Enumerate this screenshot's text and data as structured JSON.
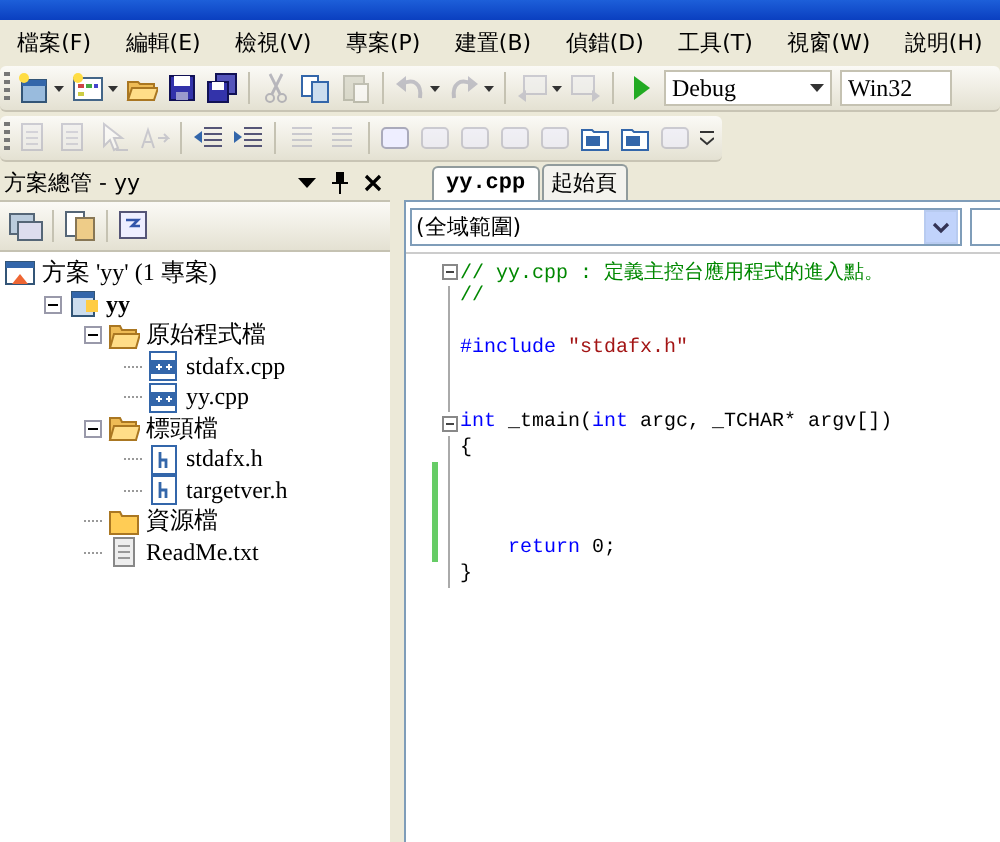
{
  "menu": [
    "檔案(F)",
    "編輯(E)",
    "檢視(V)",
    "專案(P)",
    "建置(B)",
    "偵錯(D)",
    "工具(T)",
    "視窗(W)",
    "說明(H)"
  ],
  "toolbar": [
    {
      "kind": "new-project",
      "disabled": false,
      "dropdown": true
    },
    {
      "kind": "add-item",
      "disabled": false,
      "dropdown": true
    },
    {
      "kind": "open",
      "disabled": false,
      "dropdown": false
    },
    {
      "kind": "save",
      "disabled": false,
      "dropdown": false
    },
    {
      "kind": "save-all",
      "disabled": false,
      "dropdown": false
    },
    {
      "kind": "sep"
    },
    {
      "kind": "cut",
      "disabled": true,
      "dropdown": false
    },
    {
      "kind": "copy",
      "disabled": false,
      "dropdown": false
    },
    {
      "kind": "paste",
      "disabled": true,
      "dropdown": false
    },
    {
      "kind": "sep"
    },
    {
      "kind": "undo",
      "disabled": true,
      "dropdown": true
    },
    {
      "kind": "redo",
      "disabled": true,
      "dropdown": true
    },
    {
      "kind": "sep"
    },
    {
      "kind": "back",
      "disabled": true,
      "dropdown": true
    },
    {
      "kind": "forward",
      "disabled": true,
      "dropdown": false
    },
    {
      "kind": "sep"
    },
    {
      "kind": "start",
      "disabled": false,
      "dropdown": false
    }
  ],
  "configuration": "Debug",
  "platform": "Win32",
  "toolbar2": [
    {
      "kind": "doc",
      "disabled": true
    },
    {
      "kind": "doc",
      "disabled": true
    },
    {
      "kind": "cursor",
      "disabled": true
    },
    {
      "kind": "rename",
      "disabled": true
    },
    {
      "kind": "sep"
    },
    {
      "kind": "outdent",
      "disabled": false
    },
    {
      "kind": "indent",
      "disabled": false
    },
    {
      "kind": "sep"
    },
    {
      "kind": "lines",
      "disabled": true
    },
    {
      "kind": "lines",
      "disabled": true
    },
    {
      "kind": "sep"
    },
    {
      "kind": "bookmark",
      "disabled": false
    },
    {
      "kind": "bookmark",
      "disabled": true
    },
    {
      "kind": "bookmark",
      "disabled": true
    },
    {
      "kind": "bookmark",
      "disabled": true
    },
    {
      "kind": "bookmark",
      "disabled": true
    },
    {
      "kind": "folder-bookmark",
      "disabled": false
    },
    {
      "kind": "folder-bookmark",
      "disabled": false
    },
    {
      "kind": "bookmark",
      "disabled": true
    }
  ],
  "solution_explorer": {
    "title": "方案總管 - yy",
    "tree": [
      {
        "label": "方案 'yy' (1 專案)",
        "kind": "solution",
        "children": [
          {
            "label": "yy",
            "kind": "project",
            "bold": true,
            "expanded": true,
            "children": [
              {
                "label": "原始程式檔",
                "kind": "folder",
                "expanded": true,
                "children": [
                  {
                    "label": "stdafx.cpp",
                    "kind": "cpp"
                  },
                  {
                    "label": "yy.cpp",
                    "kind": "cpp"
                  }
                ]
              },
              {
                "label": "標頭檔",
                "kind": "folder",
                "expanded": true,
                "children": [
                  {
                    "label": "stdafx.h",
                    "kind": "header"
                  },
                  {
                    "label": "targetver.h",
                    "kind": "header"
                  }
                ]
              },
              {
                "label": "資源檔",
                "kind": "folder"
              },
              {
                "label": "ReadMe.txt",
                "kind": "text"
              }
            ]
          }
        ]
      }
    ]
  },
  "editor": {
    "tabs": [
      {
        "label": "yy.cpp",
        "selected": true
      },
      {
        "label": "起始頁",
        "selected": false
      }
    ],
    "scope": "(全域範圍)",
    "lines": [
      {
        "fold": true,
        "changed": false,
        "segments": [
          {
            "kind": "comment",
            "text": "// yy.cpp : 定義主控台應用程式的進入點。"
          }
        ]
      },
      {
        "fold": false,
        "changed": false,
        "segments": [
          {
            "kind": "comment",
            "text": "//"
          }
        ]
      },
      {
        "fold": false,
        "changed": false
      },
      {
        "fold": false,
        "changed": false,
        "segments": [
          {
            "kind": "keyword",
            "text": "#include"
          },
          {
            "kind": "string",
            "text": " \"stdafx.h\""
          }
        ]
      },
      {
        "fold": false,
        "changed": false
      },
      {
        "fold": false,
        "changed": false
      },
      {
        "fold": true,
        "changed": false,
        "segments": [
          {
            "kind": "keyword",
            "text": "int"
          },
          {
            "kind": "plain",
            "text": " _tmain("
          },
          {
            "kind": "keyword",
            "text": "int"
          },
          {
            "kind": "plain",
            "text": " argc, _TCHAR* argv[])"
          }
        ]
      },
      {
        "fold": false,
        "changed": false,
        "segments": [
          {
            "kind": "plain",
            "text": "{"
          }
        ]
      },
      {
        "fold": false,
        "changed": true
      },
      {
        "fold": false,
        "changed": true
      },
      {
        "fold": false,
        "changed": true
      },
      {
        "fold": false,
        "changed": true,
        "indented": true,
        "segments": [
          {
            "kind": "keyword",
            "text": "return"
          },
          {
            "kind": "plain",
            "text": " 0;"
          }
        ]
      },
      {
        "fold": false,
        "changed": false,
        "segments": [
          {
            "kind": "plain",
            "text": "}"
          }
        ]
      }
    ]
  }
}
